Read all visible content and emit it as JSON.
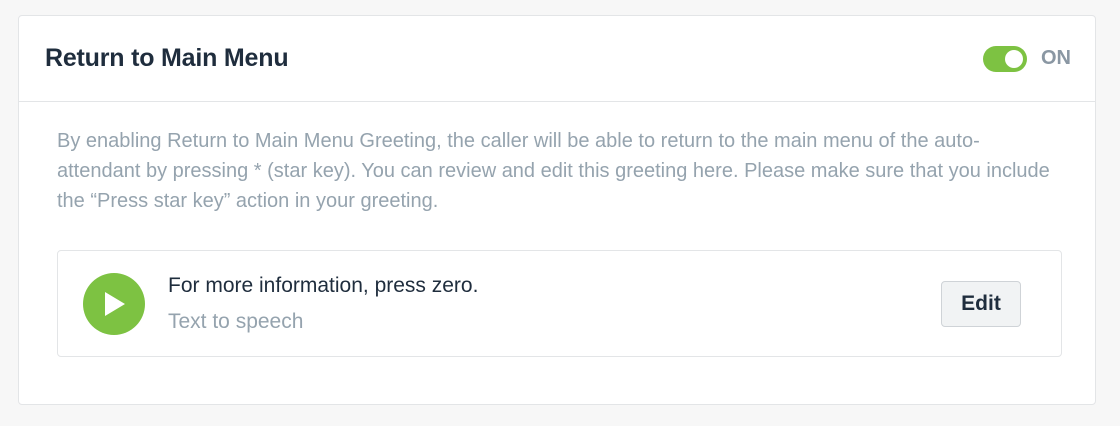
{
  "card": {
    "title": "Return to Main Menu",
    "toggle": {
      "state": "on",
      "label": "ON",
      "color": "#7dc242"
    },
    "description": "By enabling Return to Main Menu Greeting, the caller will be able to return to the main menu of the auto-attendant by pressing * (star key). You can review and edit this greeting here. Please make sure that you include the “Press star key” action in your greeting."
  },
  "greeting": {
    "play_icon": "play-icon",
    "title": "For more information, press zero.",
    "type": "Text to speech",
    "edit_label": "Edit"
  },
  "colors": {
    "accent": "#7dc242",
    "title_text": "#1f2d3d",
    "muted_text": "#95a3ae"
  }
}
